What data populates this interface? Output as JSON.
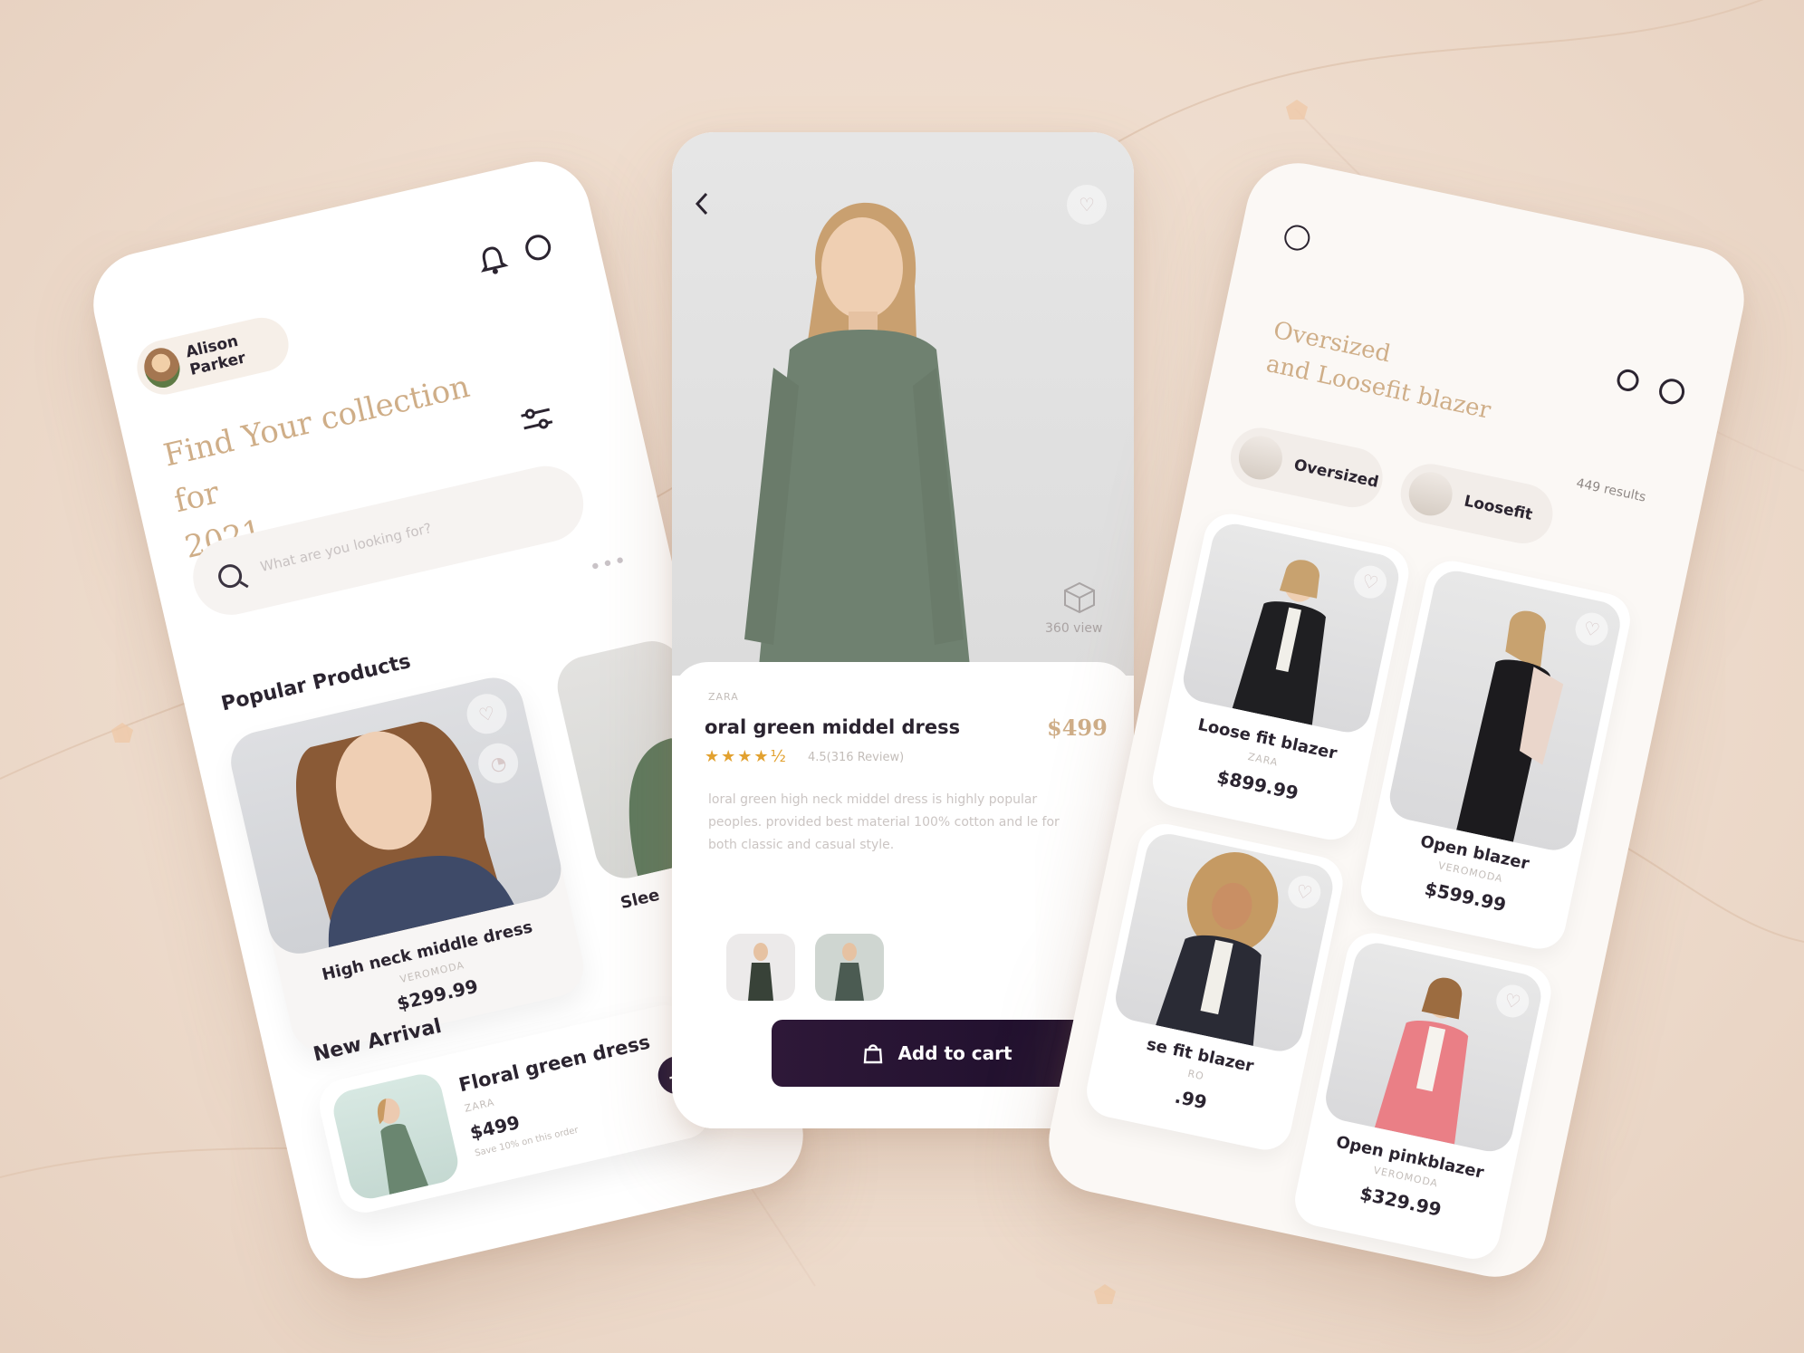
{
  "colors": {
    "background": "#eedccd",
    "accent_gold": "#cfae88",
    "dark_button": "#241636",
    "star": "#e2a12f"
  },
  "home": {
    "user_name": "Alison Parker",
    "headline_line1": "Find Your collection for",
    "headline_line2": "2021",
    "search_placeholder": "What are you looking for?",
    "popular_title": "Popular Products",
    "popular_products": [
      {
        "name": "High neck middle dress",
        "brand": "VEROMODA",
        "price": "$299.99"
      },
      {
        "name": "Slee",
        "brand": "",
        "price": ""
      }
    ],
    "new_arrival_title": "New Arrival",
    "new_arrival": {
      "name": "Floral green dress",
      "brand": "ZARA",
      "price": "$499",
      "note": "Save 10% on this order"
    },
    "icons": [
      "bell-icon",
      "power-icon",
      "search-icon",
      "filter-icon",
      "heart-icon",
      "bag-icon",
      "plus-icon"
    ]
  },
  "detail": {
    "brand": "ZARA",
    "title": "oral green middel dress",
    "price": "$499",
    "rating_text": "4.5(316 Review)",
    "rating": 4.5,
    "description": "loral green high neck middel dress is highly popular peoples. provided best material 100% cotton and le for both classic and casual style.",
    "view_360": "360 view",
    "cart_label": "Add to cart"
  },
  "listing": {
    "title_line1": "Oversized",
    "title_line2": "and Loosefit blazer",
    "results": "449 results",
    "chips": [
      {
        "label": "Oversized"
      },
      {
        "label": "Loosefit"
      }
    ],
    "products": [
      {
        "name": "Loose fit blazer",
        "brand": "ZARA",
        "price": "$899.99"
      },
      {
        "name": "Open blazer",
        "brand": "VEROMODA",
        "price": "$599.99"
      },
      {
        "name": "se fit blazer",
        "brand": "RO",
        "price": ".99"
      },
      {
        "name": "Open pinkblazer",
        "brand": "VEROMODA",
        "price": "$329.99"
      }
    ]
  }
}
